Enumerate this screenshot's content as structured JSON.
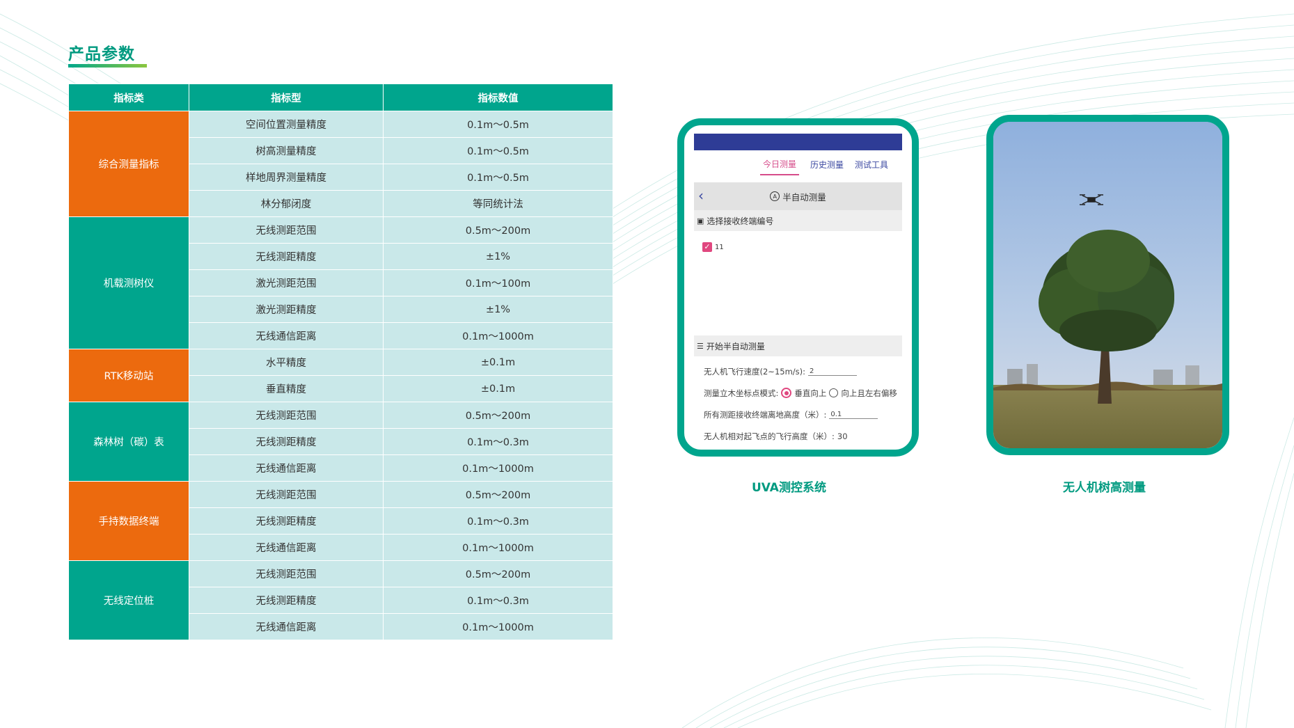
{
  "page": {
    "title": "产品参数"
  },
  "table": {
    "headers": [
      "指标类",
      "指标型",
      "指标数值"
    ],
    "groups": [
      {
        "category": "综合测量指标",
        "color": "#ec6a0e",
        "rows": [
          {
            "name": "空间位置测量精度",
            "value": "0.1m～0.5m"
          },
          {
            "name": "树高测量精度",
            "value": "0.1m～0.5m"
          },
          {
            "name": "样地周界测量精度",
            "value": "0.1m～0.5m"
          },
          {
            "name": "林分郁闭度",
            "value": "等同统计法"
          }
        ]
      },
      {
        "category": "机载测树仪",
        "color": "#00a58d",
        "rows": [
          {
            "name": "无线测距范围",
            "value": "0.5m～200m"
          },
          {
            "name": "无线测距精度",
            "value": "±1%"
          },
          {
            "name": "激光测距范围",
            "value": "0.1m～100m"
          },
          {
            "name": "激光测距精度",
            "value": "±1%"
          },
          {
            "name": "无线通信距离",
            "value": "0.1m～1000m"
          }
        ]
      },
      {
        "category": "RTK移动站",
        "color": "#ec6a0e",
        "rows": [
          {
            "name": "水平精度",
            "value": "±0.1m"
          },
          {
            "name": "垂直精度",
            "value": "±0.1m"
          }
        ]
      },
      {
        "category": "森林树（碳）表",
        "color": "#00a58d",
        "rows": [
          {
            "name": "无线测距范围",
            "value": "0.5m～200m"
          },
          {
            "name": "无线测距精度",
            "value": "0.1m～0.3m"
          },
          {
            "name": "无线通信距离",
            "value": "0.1m～1000m"
          }
        ]
      },
      {
        "category": "手持数据终端",
        "color": "#ec6a0e",
        "rows": [
          {
            "name": "无线测距范围",
            "value": "0.5m～200m"
          },
          {
            "name": "无线测距精度",
            "value": "0.1m～0.3m"
          },
          {
            "name": "无线通信距离",
            "value": "0.1m～1000m"
          }
        ]
      },
      {
        "category": "无线定位桩",
        "color": "#00a58d",
        "rows": [
          {
            "name": "无线测距范围",
            "value": "0.5m～200m"
          },
          {
            "name": "无线测距精度",
            "value": "0.1m～0.3m"
          },
          {
            "name": "无线通信距离",
            "value": "0.1m～1000m"
          }
        ]
      }
    ]
  },
  "app_screen": {
    "tabs": [
      "今日测量",
      "历史测量",
      "测试工具"
    ],
    "bar_title": "半自动测量",
    "bar_badge": "A",
    "section1": "选择接收终端编号",
    "checkbox_label": "11",
    "section2": "开始半自动测量",
    "speed_label": "无人机飞行速度(2~15m/s):",
    "speed_value": "2",
    "mode_label": "测量立木坐标点模式:",
    "mode_option1": "垂直向上",
    "mode_option2": "向上且左右偏移",
    "height_label": "所有测距接收终端离地高度（米）:",
    "height_value": "0.1",
    "flight_label": "无人机相对起飞点的飞行高度（米）:",
    "flight_value": "30"
  },
  "captions": {
    "left": "UVA测控系统",
    "right": "无人机树高测量"
  },
  "colors": {
    "teal": "#00a58d",
    "orange": "#ec6a0e",
    "cell": "#c9e8e9",
    "app_header": "#2e3c96",
    "accent_pink": "#e0477f"
  }
}
